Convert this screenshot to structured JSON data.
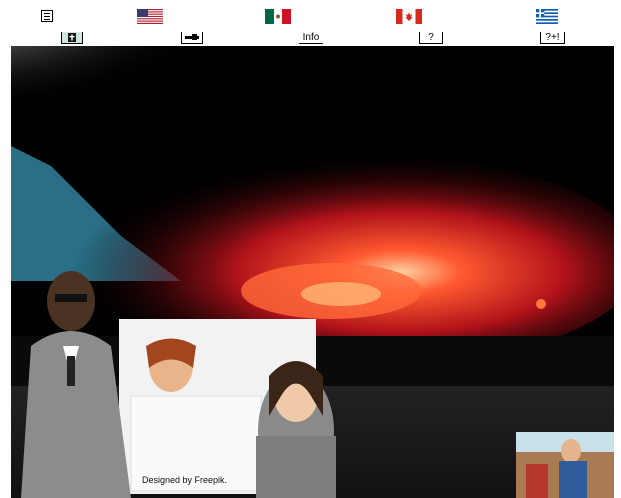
{
  "nav": {
    "flags": [
      {
        "name": "us-flag",
        "country": "United States"
      },
      {
        "name": "mexico-flag",
        "country": "Mexico"
      },
      {
        "name": "canada-flag",
        "country": "Canada"
      },
      {
        "name": "greece-flag",
        "country": "Greece"
      }
    ]
  },
  "toolbar": {
    "info_label": "Info",
    "help_label": "?",
    "plus_label": "?+!"
  },
  "hero": {
    "credit_text": "Designed by Freepik."
  },
  "colors": {
    "storm_glow": "#ff3a1a",
    "storm_core": "#ffb070",
    "sky": "#000000",
    "sea": "#2a6f86",
    "ground": "#1b1b1b"
  }
}
